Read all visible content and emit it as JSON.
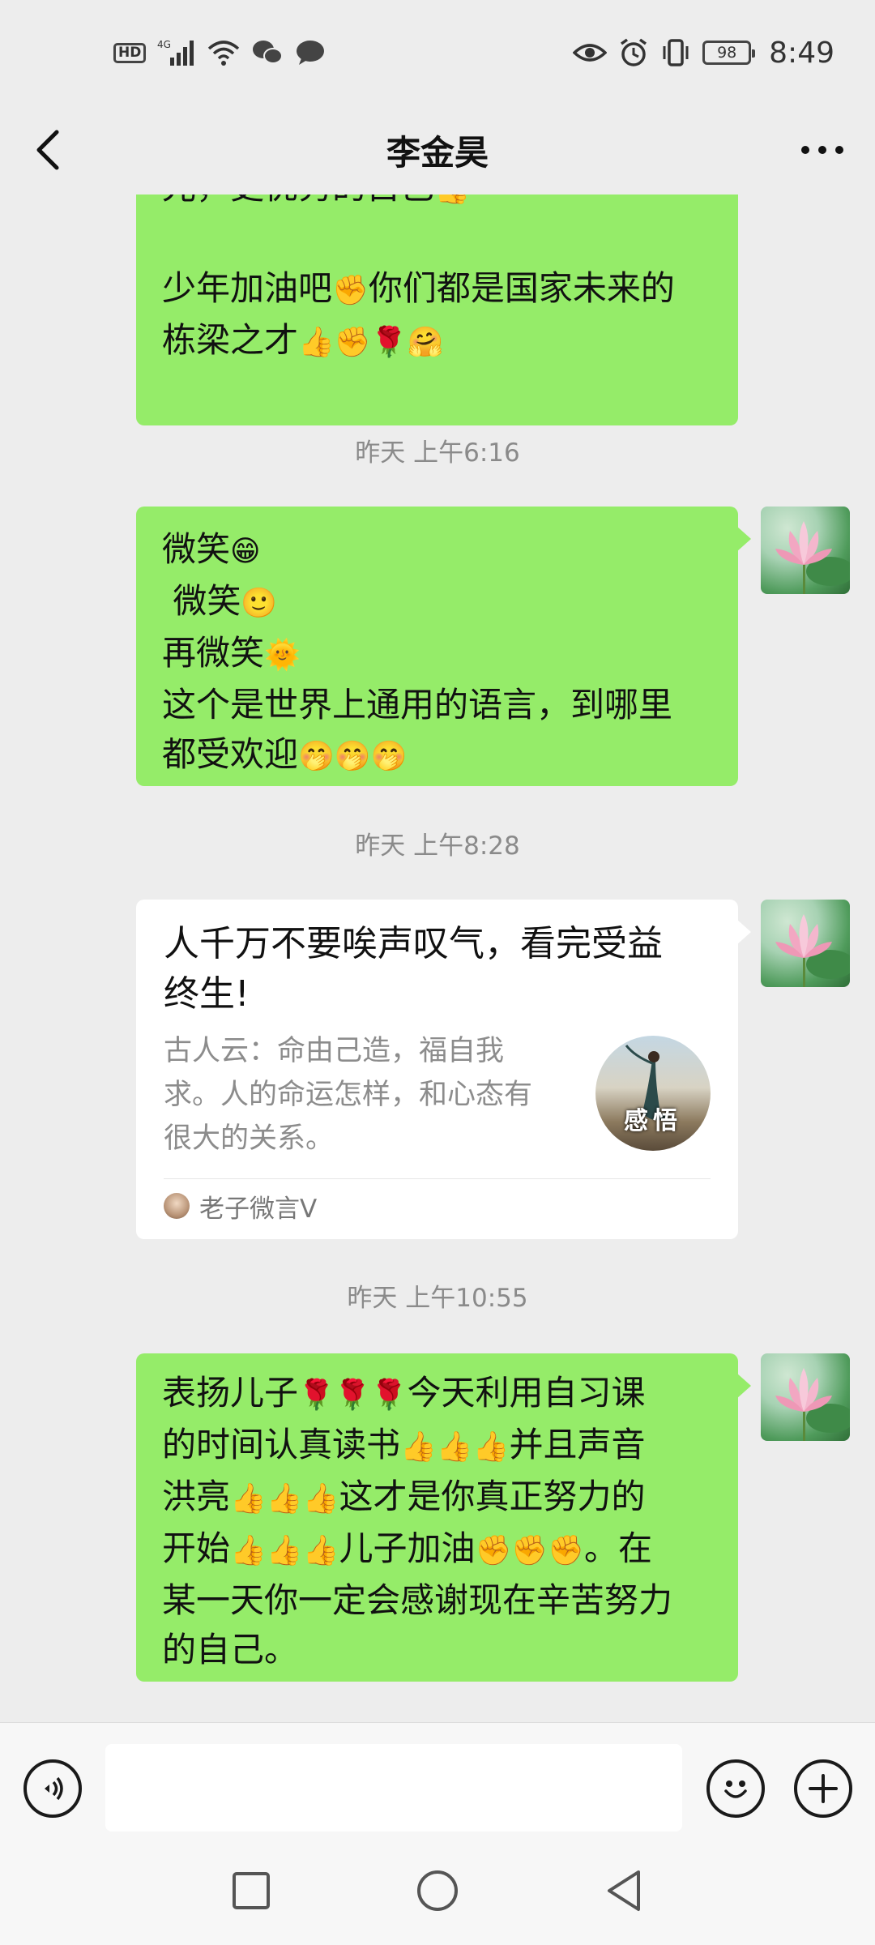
{
  "status_bar": {
    "left_icons": [
      "hd-icon",
      "signal-4g-icon",
      "wifi-icon",
      "wechat-icon",
      "message-icon"
    ],
    "hd_label": "HD",
    "network_label": "4G",
    "right_icons": [
      "eye-icon",
      "alarm-icon",
      "vibrate-icon",
      "battery-icon"
    ],
    "battery": "98",
    "time": "8:49"
  },
  "header": {
    "title": "李金昊",
    "back_icon": "chevron-left-icon",
    "more_icon": "more-horizontal-icon"
  },
  "messages": {
    "m1": {
      "lines": [
        "光，更优秀的自己",
        "",
        "少年加油吧",
        "栋梁之才"
      ],
      "line1_text": "光，更优秀的自己",
      "line1_emoji": "👍",
      "line3_a": "少年加油吧",
      "line3_e1": "✊",
      "line3_b": "你们都是国家未来的",
      "line4_a": "栋梁之才",
      "line4_emoji": "👍✊🌹🤗"
    },
    "ts1": "昨天 上午6:16",
    "m2": {
      "l1": "微笑",
      "l1e": "😁",
      "l2": " 微笑",
      "l2e": "🙂",
      "l3": "再微笑",
      "l3e": "🌞",
      "l4": "这个是世界上通用的语言，到哪里",
      "l5": "都受欢迎",
      "l5e": "🤭🤭🤭"
    },
    "ts2": "昨天 上午8:28",
    "card": {
      "title_l1": "人千万不要唉声叹气，看完受益",
      "title_l2": "终生!",
      "desc_l1": "古人云：命由己造，福自我",
      "desc_l2": "求。人的命运怎样，和心态有",
      "desc_l3": "很大的关系。",
      "thumb_text": "感悟",
      "source": "老子微言V"
    },
    "ts3": "昨天 上午10:55",
    "m3": {
      "l1a": "表扬儿子",
      "l1e": "🌹🌹🌹",
      "l1b": "今天利用自习课",
      "l2a": "的时间认真读书",
      "l2e": "👍👍👍",
      "l2b": "并且声音",
      "l3a": "洪亮",
      "l3e": "👍👍👍",
      "l3b": "这才是你真正努力的",
      "l4a": "开始",
      "l4e": "👍👍👍",
      "l4b": "儿子加油",
      "l4e2": "✊✊✊",
      "l4c": "。在",
      "l5": "某一天你一定会感谢现在辛苦努力",
      "l6": "的自己。"
    }
  },
  "input_bar": {
    "voice_icon": "voice-icon",
    "text_value": "",
    "emoji_icon": "emoji-icon",
    "plus_icon": "plus-icon"
  },
  "nav_bar": {
    "recent_icon": "square-icon",
    "home_icon": "circle-icon",
    "back_icon": "triangle-back-icon"
  },
  "colors": {
    "bubble_green": "#95ec69",
    "background": "#ededed",
    "card_white": "#ffffff"
  }
}
